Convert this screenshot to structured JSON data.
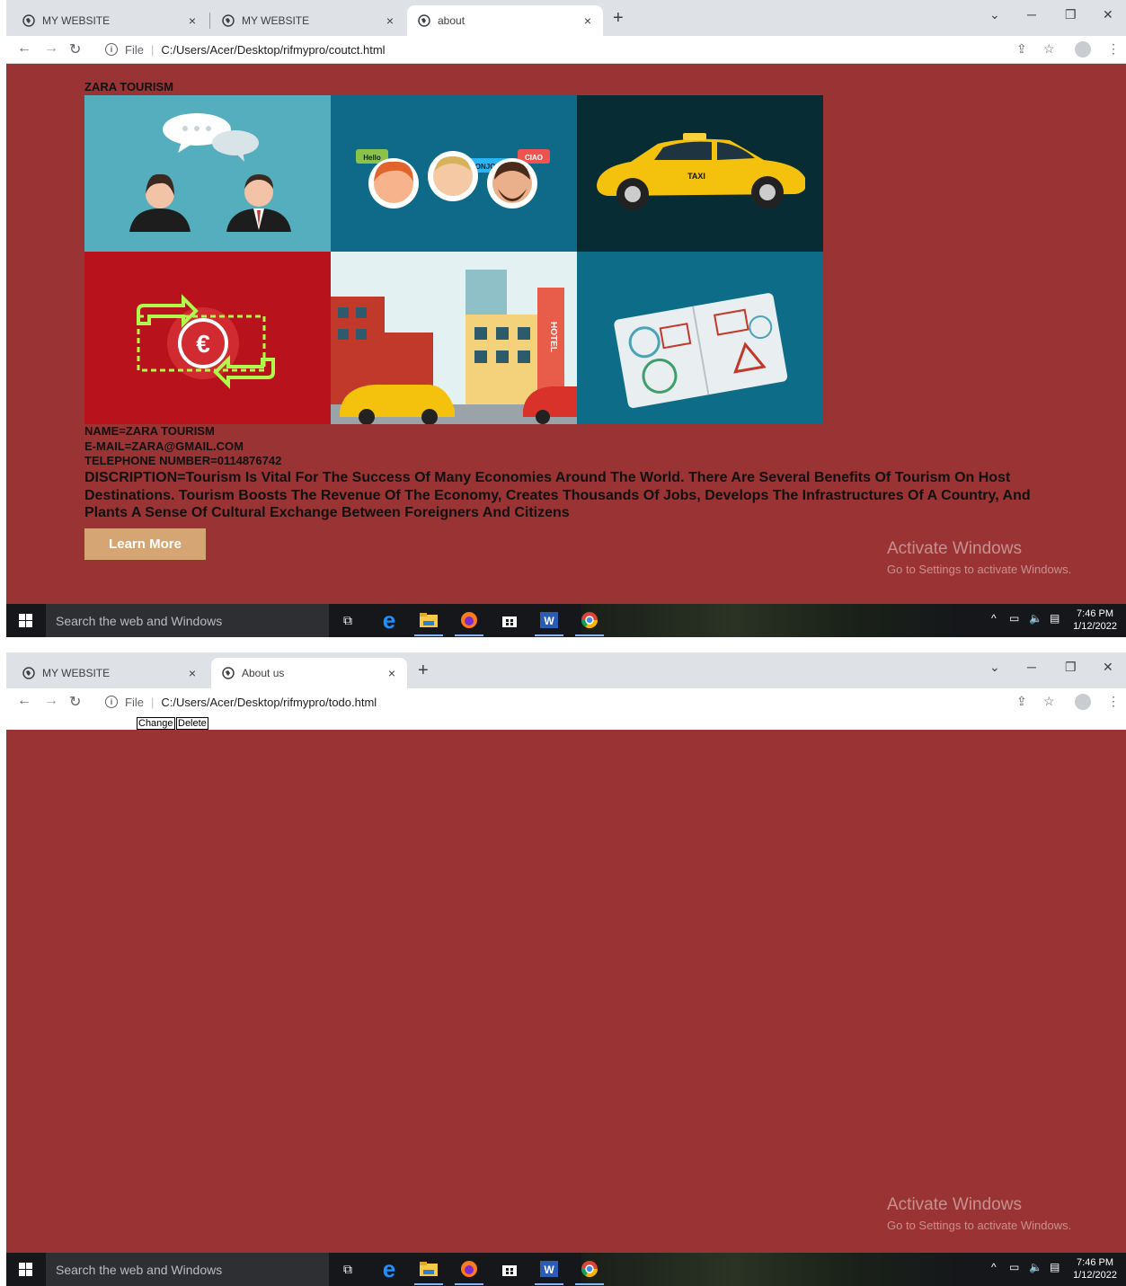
{
  "screen1": {
    "tabs": [
      {
        "title": "MY WEBSITE",
        "close": "×"
      },
      {
        "title": "MY WEBSITE",
        "close": "×"
      },
      {
        "title": "about",
        "close": "×"
      }
    ],
    "new_tab": "+",
    "url": "C:/Users/Acer/Desktop/rifmypro/coutct.html",
    "url_scheme_label": "File",
    "page": {
      "brand": "ZARA TOURISM",
      "tiles": [
        "call-center-agents",
        "multilingual-greetings",
        "taxi",
        "currency-exchange",
        "city-hotel",
        "passport-stamps"
      ],
      "tile_texts": {
        "hello": "Hello",
        "bonjour": "BONJOUR",
        "ciao": "CIAO",
        "taxi": "TAXI",
        "hotel": "HOTEL"
      },
      "name_line": "NAME=ZARA TOURISM",
      "email_line": "E-MAIL=ZARA@GMAIL.COM",
      "phone_line": "TELEPHONE NUMBER=0114876742",
      "description": "DISCRIPTION=Tourism Is Vital For The Success Of Many Economies Around The World. There Are Several Benefits Of Tourism On Host Destinations. Tourism Boosts The Revenue Of The Economy, Creates Thousands Of Jobs, Develops The Infrastructures Of A Country, And Plants A Sense Of Cultural Exchange Between Foreigners And Citizens",
      "learn_more": "Learn More"
    },
    "watermark": {
      "title": "Activate Windows",
      "subtitle": "Go to Settings to activate Windows."
    },
    "taskbar": {
      "search_placeholder": "Search the web and Windows",
      "time": "7:46 PM",
      "date": "1/12/2022"
    }
  },
  "screen2": {
    "tabs": [
      {
        "title": "MY WEBSITE",
        "close": "×"
      },
      {
        "title": "About us",
        "close": "×"
      }
    ],
    "new_tab": "+",
    "url": "C:/Users/Acer/Desktop/rifmypro/todo.html",
    "url_scheme_label": "File",
    "page": {
      "change_button": "Change",
      "delete_button": "Delete"
    },
    "watermark": {
      "title": "Activate Windows",
      "subtitle": "Go to Settings to activate Windows."
    },
    "taskbar": {
      "search_placeholder": "Search the web and Windows",
      "time": "7:46 PM",
      "date": "1/12/2022"
    }
  },
  "colors": {
    "page_bg": "#993334",
    "button_bg": "#d5a574",
    "tab_strip": "#dee1e6"
  }
}
